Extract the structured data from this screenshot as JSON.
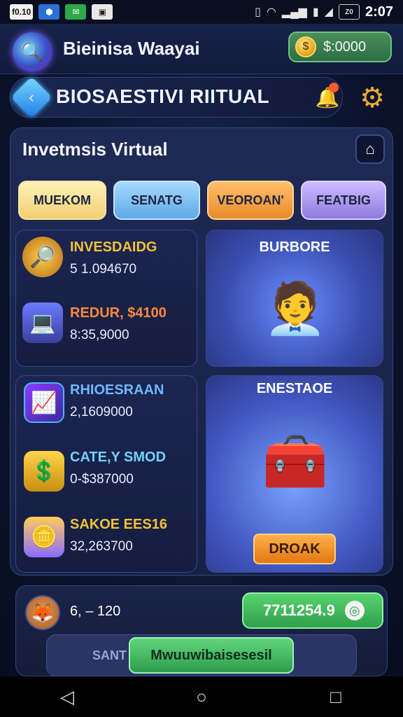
{
  "status_bar": {
    "left_badge": "f0.10",
    "time": "2:07",
    "battery_label": "Z0"
  },
  "header": {
    "app_title": "Bieinisa Waayai",
    "balance": "$:0000",
    "coin_symbol": "$"
  },
  "banner": {
    "title": "BIOSAESTIVI RIITUAL"
  },
  "panel": {
    "title": "Invetmsis Virtual",
    "tabs": [
      {
        "label": "MUEKOM"
      },
      {
        "label": "SENATG"
      },
      {
        "label": "VEOROAN'"
      },
      {
        "label": "FEATBIG"
      }
    ]
  },
  "left_top": {
    "rows": [
      {
        "label": "INVESDAIDG",
        "value": "5 1.094670",
        "color": "#f0c23a",
        "icon": "magnifier-coin-icon"
      },
      {
        "label": "REDUR, $4100",
        "value": "8:35,9000",
        "color": "#ff8a3c",
        "icon": "laptop-stack-icon"
      }
    ]
  },
  "right_top": {
    "heading": "BURBORE",
    "icon": "businessman-clipboard-icon"
  },
  "left_bottom": {
    "rows": [
      {
        "label": "RHIOESRAAN",
        "value": "2,1609000",
        "color": "#6fb8ff",
        "icon": "chart-hexagon-icon"
      },
      {
        "label": "CATE,Y SMOD",
        "value": "0-$387000",
        "color": "#6fd3ff",
        "icon": "coin-box-icon"
      },
      {
        "label": "SAKOE EES16",
        "value": "32,263700",
        "color": "#f0c23a",
        "icon": "stacked-coins-icon"
      }
    ]
  },
  "right_bottom": {
    "heading": "ENESTAOE",
    "icon": "safe-coins-icon",
    "button": "DROAK"
  },
  "footer": {
    "stat": "6, – 120",
    "green_value": "7711254.9",
    "sub_left": "SANT",
    "submit": "Mwuuwibaisesesil"
  }
}
